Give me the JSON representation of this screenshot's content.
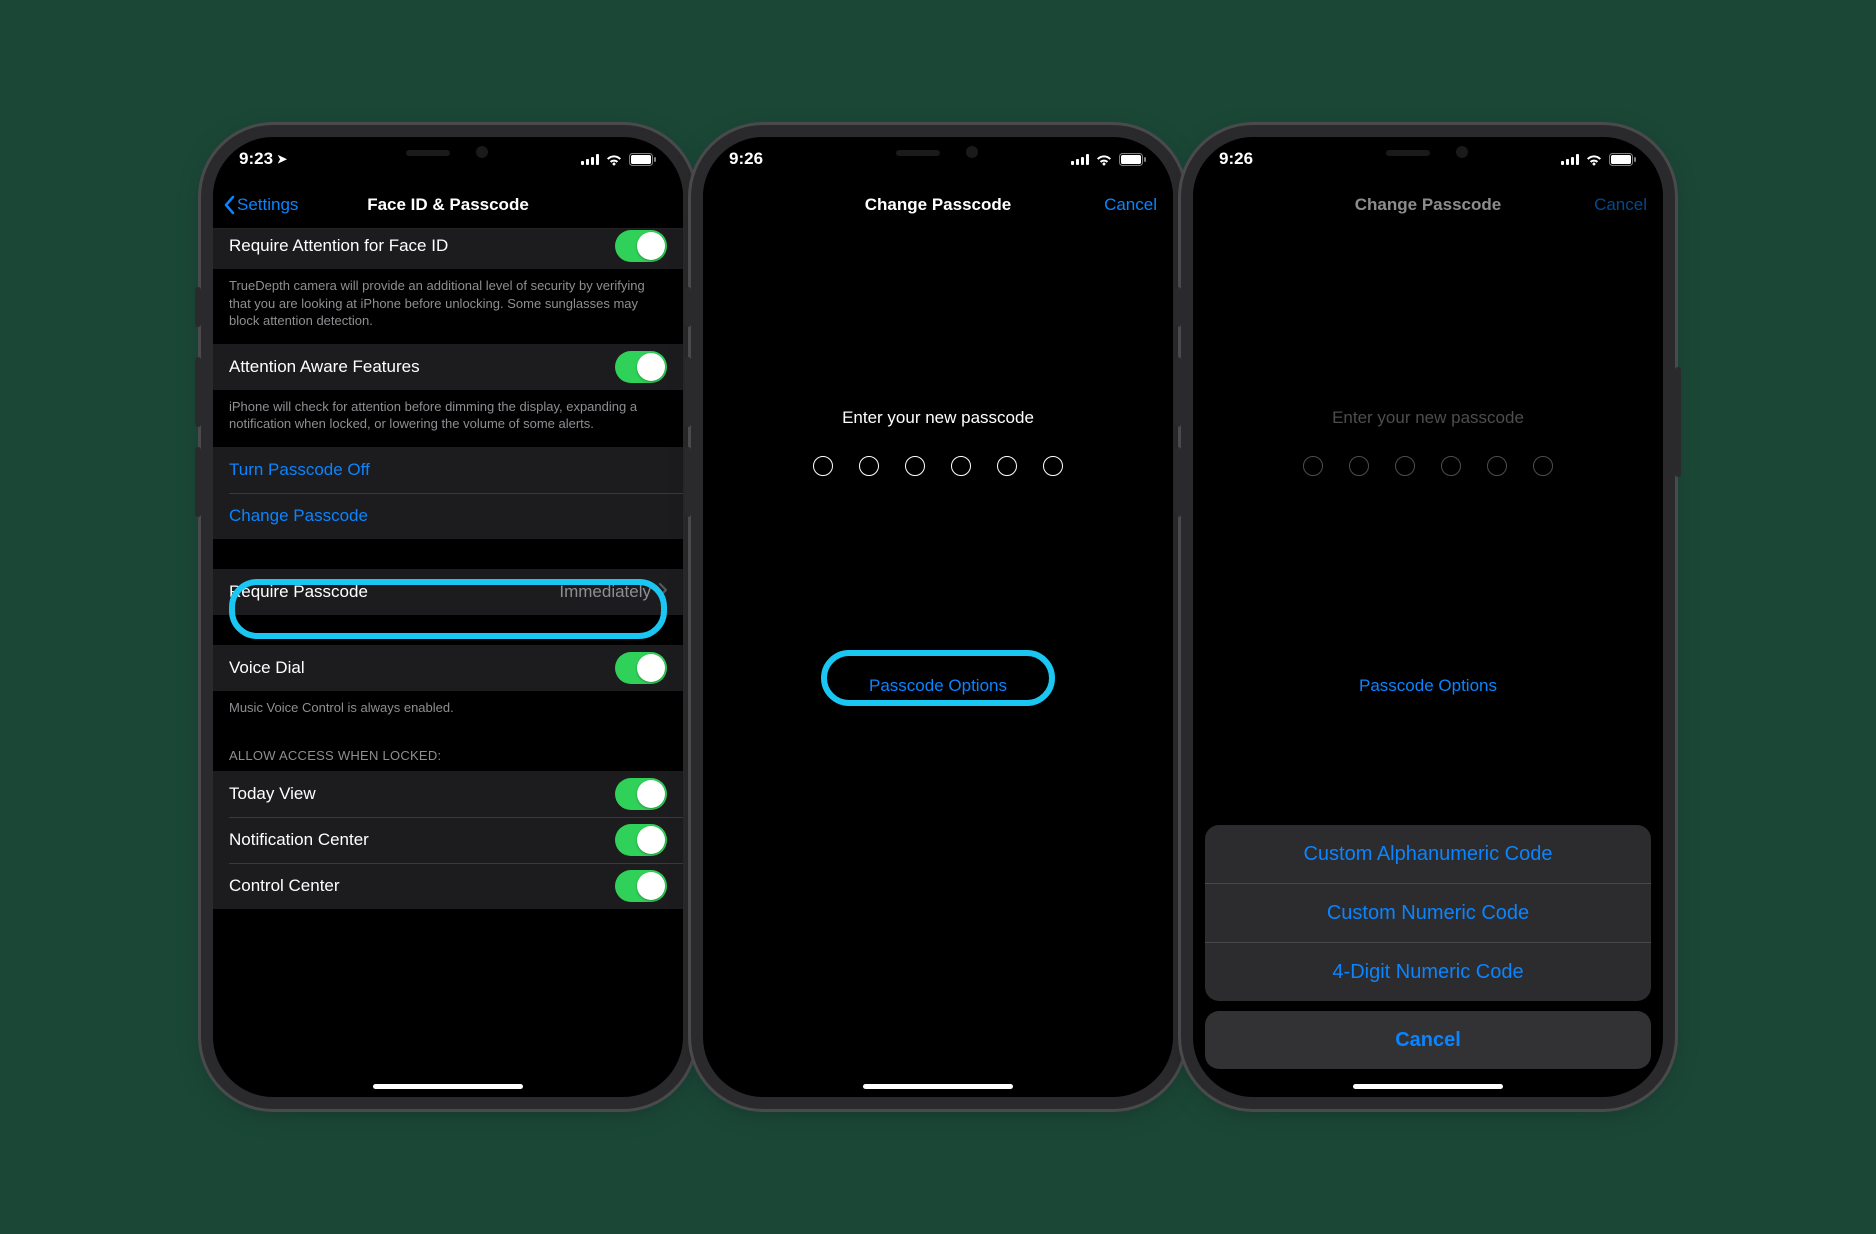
{
  "status": {
    "time_a": "9:23",
    "time_b": "9:26",
    "time_c": "9:26"
  },
  "screen1": {
    "back": "Settings",
    "title": "Face ID & Passcode",
    "row_attention": "Require Attention for Face ID",
    "foot_attention": "TrueDepth camera will provide an additional level of security by verifying that you are looking at iPhone before unlocking. Some sunglasses may block attention detection.",
    "row_aware": "Attention Aware Features",
    "foot_aware": "iPhone will check for attention before dimming the display, expanding a notification when locked, or lowering the volume of some alerts.",
    "row_turn_off": "Turn Passcode Off",
    "row_change": "Change Passcode",
    "row_require": "Require Passcode",
    "val_require": "Immediately",
    "row_voice": "Voice Dial",
    "foot_voice": "Music Voice Control is always enabled.",
    "hdr_allow": "ALLOW ACCESS WHEN LOCKED:",
    "row_today": "Today View",
    "row_notif": "Notification Center",
    "row_cc": "Control Center"
  },
  "screen2": {
    "title": "Change Passcode",
    "cancel": "Cancel",
    "prompt": "Enter your new passcode",
    "options": "Passcode Options"
  },
  "screen3": {
    "title": "Change Passcode",
    "cancel": "Cancel",
    "prompt": "Enter your new passcode",
    "options": "Passcode Options",
    "sheet": {
      "alpha": "Custom Alphanumeric Code",
      "numeric": "Custom Numeric Code",
      "four": "4-Digit Numeric Code",
      "cancel": "Cancel"
    }
  }
}
